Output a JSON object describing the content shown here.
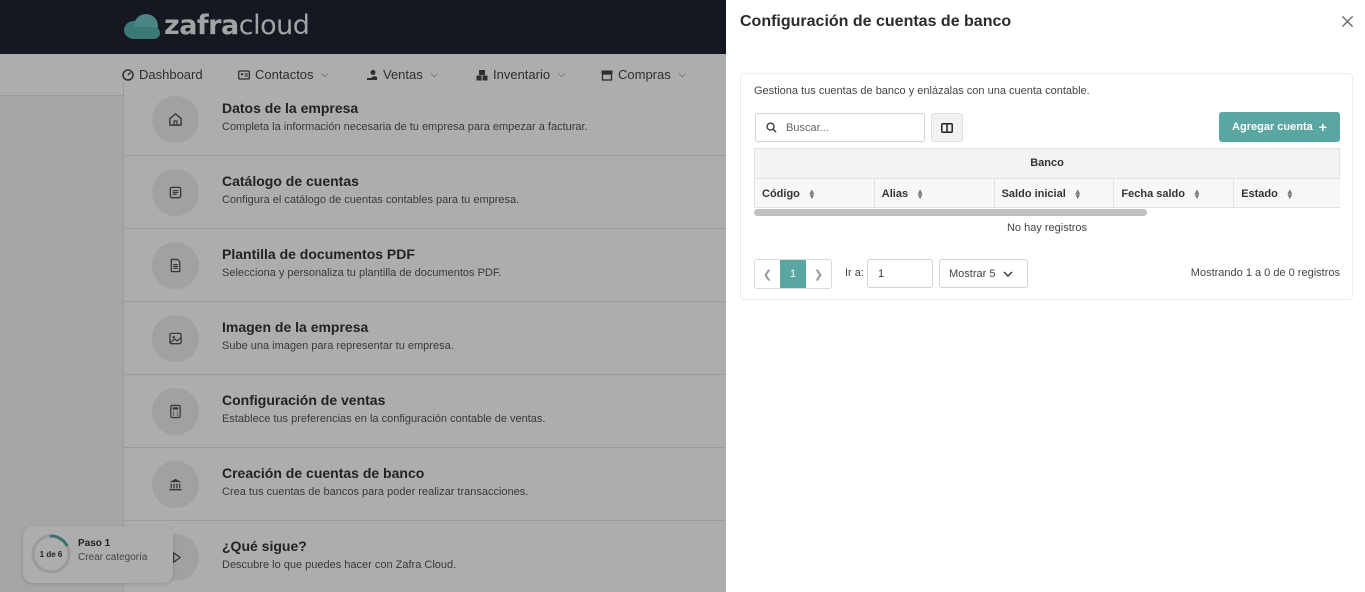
{
  "app": {
    "logo_bold": "zafra",
    "logo_light": "cloud"
  },
  "nav": {
    "items": [
      {
        "label": "Dashboard",
        "icon": "dashboard-icon"
      },
      {
        "label": "Contactos",
        "icon": "contacts-icon"
      },
      {
        "label": "Ventas",
        "icon": "sales-icon"
      },
      {
        "label": "Inventario",
        "icon": "inventory-icon"
      },
      {
        "label": "Compras",
        "icon": "store-icon"
      }
    ]
  },
  "steps": [
    {
      "title": "Datos de la empresa",
      "desc": "Completa la información necesaria de tu empresa para empezar a facturar.",
      "icon": "home-icon"
    },
    {
      "title": "Catálogo de cuentas",
      "desc": "Configura el catálogo de cuentas contables para tu empresa.",
      "icon": "list-icon"
    },
    {
      "title": "Plantilla de documentos PDF",
      "desc": "Selecciona y personaliza tu plantilla de documentos PDF.",
      "icon": "document-icon"
    },
    {
      "title": "Imagen de la empresa",
      "desc": "Sube una imagen para representar tu empresa.",
      "icon": "image-icon"
    },
    {
      "title": "Configuración de ventas",
      "desc": "Establece tus preferencias en la configuración contable de ventas.",
      "icon": "calculator-icon"
    },
    {
      "title": "Creación de cuentas de banco",
      "desc": "Crea tus cuentas de bancos para poder realizar transacciones.",
      "icon": "bank-icon"
    },
    {
      "title": "¿Qué sigue?",
      "desc": "Descubre lo que puedes hacer con Zafra Cloud.",
      "icon": "play-icon"
    }
  ],
  "progress": {
    "counter": "1 de 6",
    "fraction": 0.167,
    "title": "Paso 1",
    "subtitle": "Crear categoría"
  },
  "drawer": {
    "title": "Configuración de cuentas de banco",
    "description": "Gestiona tus cuentas de banco y enlázalas con una cuenta contable.",
    "search_placeholder": "Buscar...",
    "add_label": "Agregar cuenta",
    "group_header": "Banco",
    "columns": [
      "Código",
      "Alias",
      "Saldo inicial",
      "Fecha saldo",
      "Estado"
    ],
    "empty_text": "No hay registros",
    "pager": {
      "current": "1",
      "goto_label": "Ir a:",
      "goto_value": "1",
      "show_label": "Mostrar 5"
    },
    "showing_text": "Mostrando 1 a 0 de 0 registros"
  },
  "colors": {
    "accent": "#5aa6a3",
    "topbar": "#1f2430"
  }
}
